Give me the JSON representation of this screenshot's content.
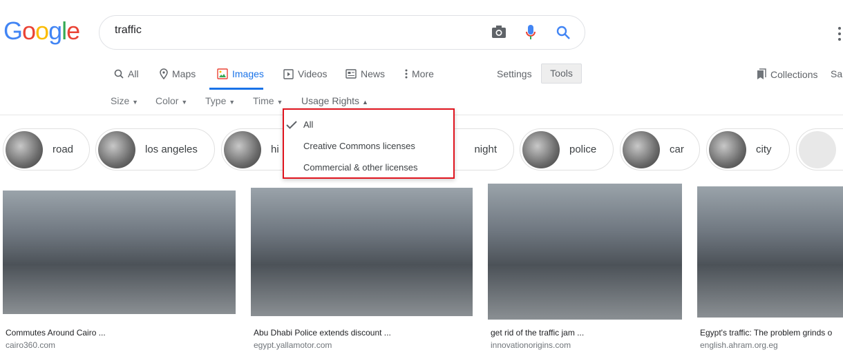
{
  "logo": {
    "text": "Google",
    "colors": [
      "#4285f4",
      "#ea4335",
      "#fbbc05",
      "#4285f4",
      "#34a853",
      "#ea4335"
    ]
  },
  "search": {
    "query": "traffic",
    "icons": [
      "camera-icon",
      "mic-icon",
      "search-icon"
    ]
  },
  "nav": {
    "tabs": [
      {
        "label": "All",
        "icon": "search-icon"
      },
      {
        "label": "Maps",
        "icon": "map-pin-icon"
      },
      {
        "label": "Images",
        "icon": "image-icon",
        "active": true
      },
      {
        "label": "Videos",
        "icon": "play-icon"
      },
      {
        "label": "News",
        "icon": "news-icon"
      },
      {
        "label": "More",
        "icon": "more-vert-icon"
      }
    ],
    "settings": "Settings",
    "tools": "Tools",
    "collections": "Collections",
    "saved": "Sa"
  },
  "filters": [
    "Size",
    "Color",
    "Type",
    "Time",
    "Usage Rights"
  ],
  "usage_dropdown": {
    "items": [
      {
        "label": "All",
        "selected": true
      },
      {
        "label": "Creative Commons licenses"
      },
      {
        "label": "Commercial & other licenses"
      }
    ]
  },
  "chips": [
    "road",
    "los angeles",
    "hi",
    "night",
    "police",
    "car",
    "city",
    ""
  ],
  "results": [
    {
      "title": "Commutes Around Cairo ...",
      "domain": "cairo360.com"
    },
    {
      "title": "Abu Dhabi Police extends discount ...",
      "domain": "egypt.yallamotor.com"
    },
    {
      "title": "get rid of the traffic jam ...",
      "domain": "innovationorigins.com"
    },
    {
      "title": "Egypt's traffic: The problem grinds o",
      "domain": "english.ahram.org.eg"
    }
  ],
  "colors": {
    "accent": "#1a73e8",
    "highlight_border": "#e0141e"
  }
}
